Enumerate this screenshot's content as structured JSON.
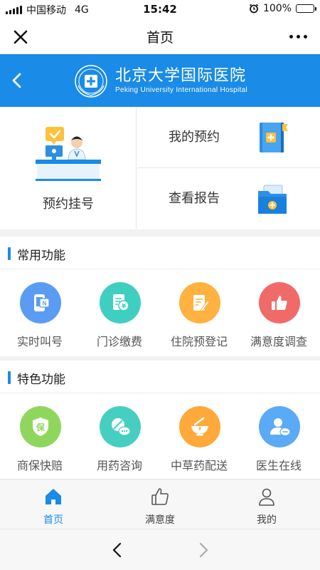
{
  "status_bar": {
    "carrier": "中国移动",
    "network": "4G",
    "time": "15:42",
    "battery": "100%",
    "battery_level": 1.0
  },
  "top_nav": {
    "title": "首页",
    "close_icon": "close-icon",
    "more_icon": "more-icon"
  },
  "hospital_header": {
    "name_cn": "北京大学国际医院",
    "name_en": "Peking University International Hospital",
    "back_icon": "chevron-left-icon",
    "brand_color": "#1a8be6"
  },
  "quick_actions": {
    "main": {
      "label": "预约挂号",
      "icon": "appointment-illustration"
    },
    "items": [
      {
        "label": "我的预约",
        "icon": "medical-folder-icon"
      },
      {
        "label": "查看报告",
        "icon": "report-folder-icon"
      }
    ]
  },
  "common_section": {
    "title": "常用功能",
    "items": [
      {
        "label": "实时叫号",
        "icon": "phone-queue-icon",
        "color": "#5a9cf4"
      },
      {
        "label": "门诊缴费",
        "icon": "payment-icon",
        "color": "#3ecfc0"
      },
      {
        "label": "住院预登记",
        "icon": "edit-form-icon",
        "color": "#ffb23f"
      },
      {
        "label": "满意度调查",
        "icon": "thumbs-up-icon",
        "color": "#f06a6a"
      }
    ]
  },
  "feature_section": {
    "title": "特色功能",
    "items": [
      {
        "label": "商保快赔",
        "icon": "shield-icon",
        "color": "#8ed75c",
        "glyph": "保"
      },
      {
        "label": "用药咨询",
        "icon": "pill-chat-icon",
        "color": "#46cfc1"
      },
      {
        "label": "中草药配送",
        "icon": "herb-bowl-icon",
        "color": "#ffa93b"
      },
      {
        "label": "医生在线",
        "icon": "doctor-chat-icon",
        "color": "#5aaaf5"
      }
    ]
  },
  "tab_bar": {
    "active_color": "#1a8be6",
    "tabs": [
      {
        "label": "首页",
        "icon": "home-icon",
        "active": true
      },
      {
        "label": "满意度",
        "icon": "thumbs-up-outline-icon",
        "active": false
      },
      {
        "label": "我的",
        "icon": "user-icon",
        "active": false
      }
    ]
  },
  "browser_bar": {
    "back_icon": "back-arrow-icon",
    "forward_icon": "forward-arrow-icon"
  }
}
